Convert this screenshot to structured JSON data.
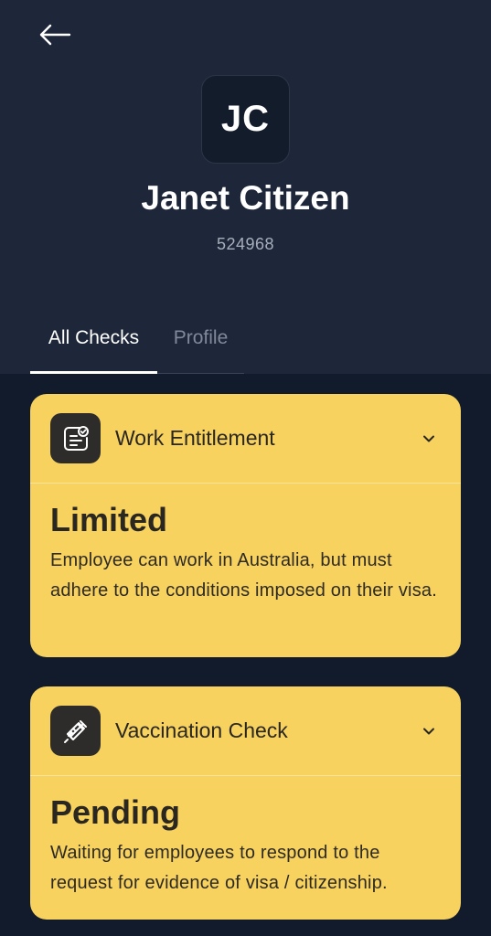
{
  "header": {
    "initials": "JC",
    "name": "Janet Citizen",
    "employee_id": "524968"
  },
  "tabs": [
    {
      "label": "All Checks",
      "active": true
    },
    {
      "label": "Profile",
      "active": false
    }
  ],
  "checks": [
    {
      "title": "Work Entitlement",
      "icon": "document-check-icon",
      "status": "Limited",
      "description": "Employee can work in Australia, but must adhere to the conditions imposed on their visa."
    },
    {
      "title": "Vaccination Check",
      "icon": "syringe-icon",
      "status": "Pending",
      "description": "Waiting for employees to respond to the request for evidence of visa / citizenship."
    }
  ],
  "colors": {
    "header_bg": "#1e2739",
    "page_bg": "#111b2b",
    "card_bg": "#f7d25f",
    "icon_tile": "#2d2c2b"
  }
}
